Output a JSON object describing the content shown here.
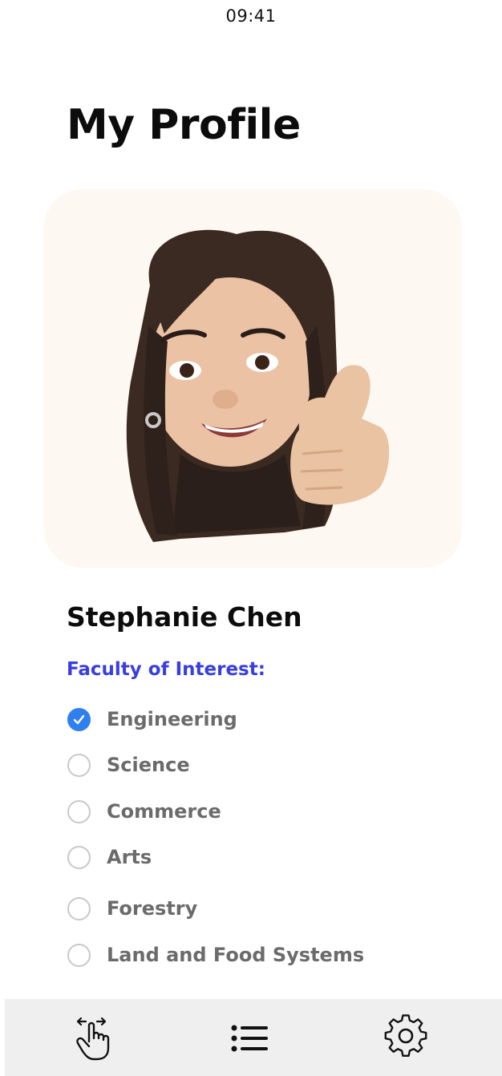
{
  "status_bar": {
    "time": "09:41"
  },
  "page": {
    "title": "My Profile"
  },
  "profile": {
    "avatar_icon": "memoji-thumbs-up-avatar",
    "card_color": "#fdf8f1",
    "name": "Stephanie Chen"
  },
  "faculty": {
    "label": "Faculty of Interest:",
    "label_color": "#3a3ee0",
    "selected": "Engineering",
    "options": [
      {
        "label": "Engineering",
        "checked": true
      },
      {
        "label": "Science",
        "checked": false
      },
      {
        "label": "Commerce",
        "checked": false
      },
      {
        "label": "Arts",
        "checked": false
      },
      {
        "label": "Forestry",
        "checked": false
      },
      {
        "label": "Land and Food Systems",
        "checked": false
      }
    ],
    "check_color": "#2f7ff0"
  },
  "tab_bar": {
    "items": [
      {
        "icon": "swipe-gesture-icon"
      },
      {
        "icon": "list-icon"
      },
      {
        "icon": "gear-icon"
      }
    ]
  }
}
